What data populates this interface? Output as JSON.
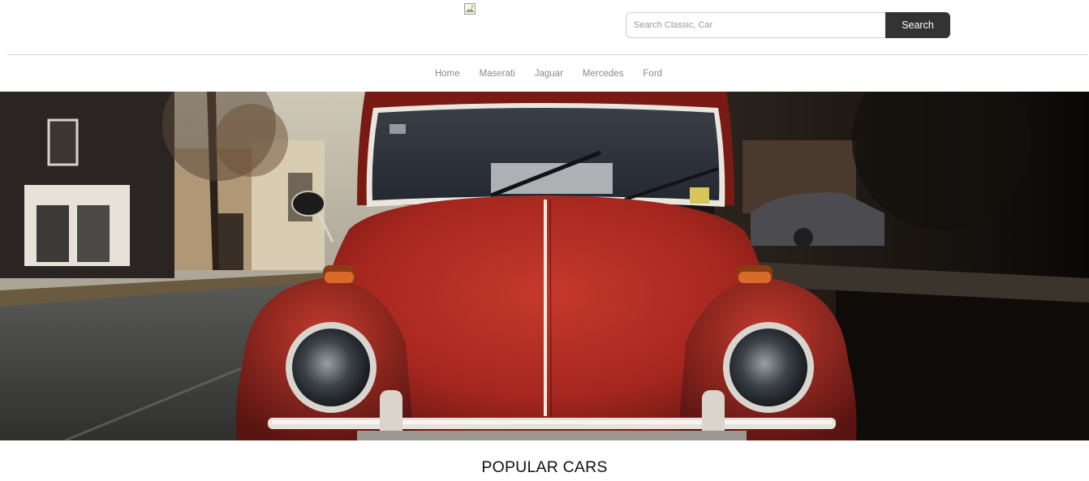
{
  "header": {
    "logo_icon": "broken-image-icon",
    "search": {
      "placeholder": "Search Classic, Car",
      "value": "",
      "button_label": "Search"
    }
  },
  "nav": {
    "items": [
      {
        "label": "Home"
      },
      {
        "label": "Maserati"
      },
      {
        "label": "Jaguar"
      },
      {
        "label": "Mercedes"
      },
      {
        "label": "Ford"
      }
    ]
  },
  "hero": {
    "image": "red-classic-beetle-photo"
  },
  "main": {
    "section_title": "POPULAR CARS"
  },
  "colors": {
    "button_bg": "#333333",
    "button_text": "#ffffff",
    "nav_text": "#8a8a8a",
    "car_red": "#b12a22"
  }
}
